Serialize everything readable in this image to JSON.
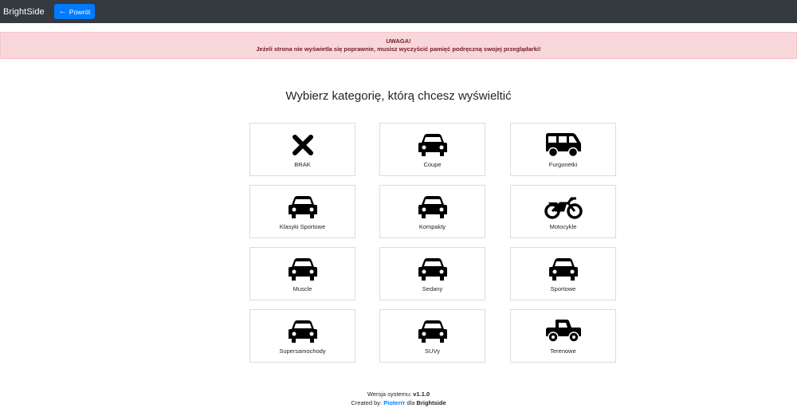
{
  "navbar": {
    "brand": "BrightSide",
    "back_label": "Powrót"
  },
  "alert": {
    "title": "UWAGA!",
    "message": "Jeżeli strona nie wyświetla się poprawnie, musisz wyczyścić pamięć podręczną swojej przeglądarki!"
  },
  "page": {
    "heading": "Wybierz kategorię, którą chcesz wyświeltić"
  },
  "categories": [
    {
      "label": "BRAK",
      "icon": "close-icon"
    },
    {
      "label": "Coupe",
      "icon": "car-icon"
    },
    {
      "label": "Furgonetki",
      "icon": "van-icon"
    },
    {
      "label": "Klasyki Sportowe",
      "icon": "car-icon"
    },
    {
      "label": "Kompakty",
      "icon": "car-icon"
    },
    {
      "label": "Motocykle",
      "icon": "motorcycle-icon"
    },
    {
      "label": "Muscle",
      "icon": "car-icon"
    },
    {
      "label": "Sedany",
      "icon": "car-icon"
    },
    {
      "label": "Sportowe",
      "icon": "car-icon"
    },
    {
      "label": "Supersamochody",
      "icon": "car-icon"
    },
    {
      "label": "SUVy",
      "icon": "car-icon"
    },
    {
      "label": "Terenowe",
      "icon": "truck-pickup-icon"
    }
  ],
  "footer": {
    "version_prefix": "Wersja systemu:",
    "version": "v1.1.0",
    "created_prefix": "Created by:",
    "author": "Pioterrr",
    "created_mid": "dla",
    "company": "Brightside"
  },
  "colors": {
    "navbar": "#343a40",
    "primary": "#007bff",
    "alert_bg": "#f8d7da",
    "alert_text": "#721c24"
  }
}
